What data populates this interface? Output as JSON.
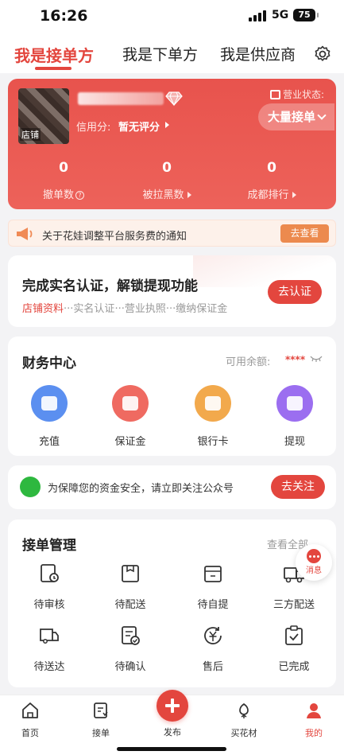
{
  "status_bar": {
    "time": "16:26",
    "network": "5G",
    "battery": "75"
  },
  "top_tabs": [
    {
      "label": "我是接单方",
      "active": true
    },
    {
      "label": "我是下单方",
      "active": false
    },
    {
      "label": "我是供应商",
      "active": false
    }
  ],
  "store": {
    "avatar_label": "店铺",
    "credit_label": "信用分:",
    "credit_value": "暂无评分",
    "business_status_label": "营业状态:",
    "business_status_value": "大量接单",
    "stats": [
      {
        "value": "0",
        "label": "撤单数"
      },
      {
        "value": "0",
        "label": "被拉黑数"
      },
      {
        "value": "0",
        "label": "成都排行"
      }
    ]
  },
  "notice": {
    "text": "关于花娃调整平台服务费的通知",
    "button": "去查看"
  },
  "verify": {
    "title": "完成实名认证，解锁提现功能",
    "steps": [
      "店铺资料",
      "实名认证",
      "营业执照",
      "缴纳保证金"
    ],
    "button": "去认证"
  },
  "finance": {
    "title": "财务中心",
    "balance_label": "可用余额:",
    "balance_value": "****",
    "items": [
      {
        "label": "充值",
        "icon": "wallet-icon",
        "color": "#5b8ff0"
      },
      {
        "label": "保证金",
        "icon": "deposit-icon",
        "color": "#ef6a61"
      },
      {
        "label": "银行卡",
        "icon": "bank-card-icon",
        "color": "#f2a94c"
      },
      {
        "label": "提现",
        "icon": "withdraw-icon",
        "color": "#9b6ef0"
      }
    ]
  },
  "wechat": {
    "text": "为保障您的资金安全，请立即关注公众号",
    "button": "去关注"
  },
  "orders": {
    "title": "接单管理",
    "view_all": "查看全部",
    "items": [
      {
        "label": "待审核",
        "icon": "pending-review-icon"
      },
      {
        "label": "待配送",
        "icon": "pending-delivery-icon"
      },
      {
        "label": "待自提",
        "icon": "pickup-icon"
      },
      {
        "label": "三方配送",
        "icon": "truck-icon"
      },
      {
        "label": "待送达",
        "icon": "in-transit-icon"
      },
      {
        "label": "待确认",
        "icon": "pending-confirm-icon"
      },
      {
        "label": "售后",
        "icon": "after-sales-icon"
      },
      {
        "label": "已完成",
        "icon": "completed-icon"
      }
    ]
  },
  "message_float": {
    "label": "消息"
  },
  "bottom_nav": [
    {
      "label": "首页",
      "icon": "home-icon"
    },
    {
      "label": "接单",
      "icon": "orders-icon"
    },
    {
      "label": "发布",
      "icon": "plus-icon"
    },
    {
      "label": "买花材",
      "icon": "flower-icon"
    },
    {
      "label": "我的",
      "icon": "profile-icon",
      "active": true
    }
  ]
}
